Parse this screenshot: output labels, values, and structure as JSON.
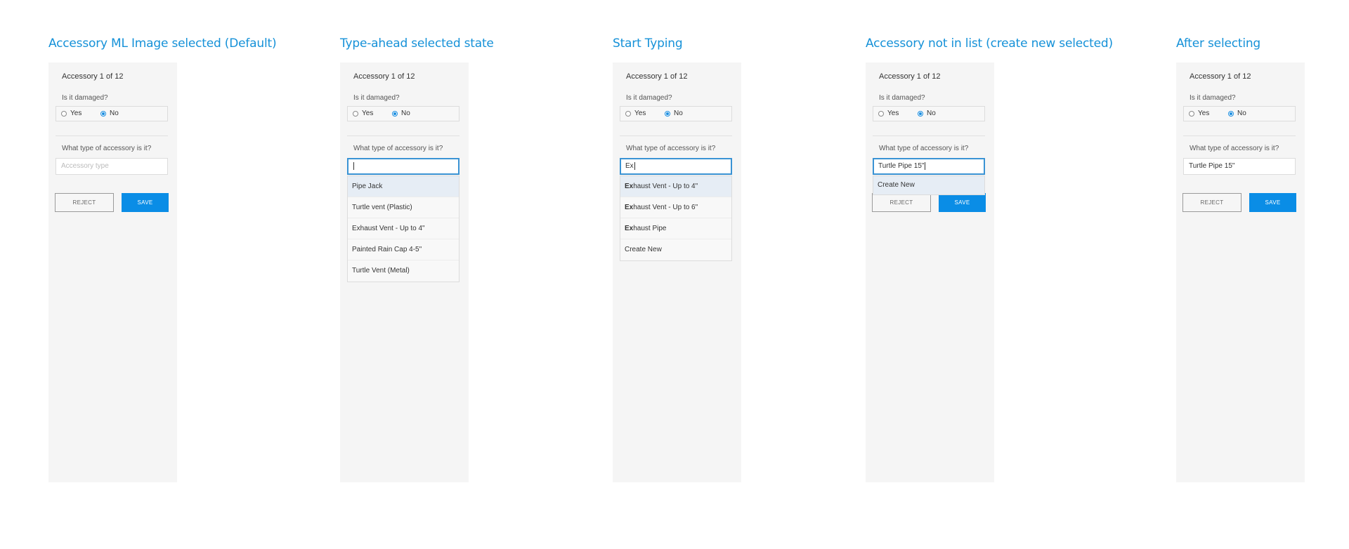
{
  "common": {
    "counter": "Accessory 1 of 12",
    "damaged_question": "Is it damaged?",
    "yes_label": "Yes",
    "no_label": "No",
    "type_question": "What type of accessory is it?",
    "reject_label": "REJECT",
    "save_label": "SAVE"
  },
  "columns": [
    {
      "title": "Accessory ML Image selected (Default)",
      "input_value": "",
      "input_placeholder": "Accessory type"
    },
    {
      "title": "Type-ahead selected state",
      "input_value": "",
      "dropdown": [
        "Pipe Jack",
        "Turtle vent (Plastic)",
        "Exhaust Vent - Up to 4\"",
        "Painted Rain Cap 4-5\"",
        "Turtle Vent (Metal)"
      ]
    },
    {
      "title": "Start Typing",
      "input_value": "Ex",
      "dropdown": [
        {
          "match": "Ex",
          "rest": "haust Vent - Up to 4\""
        },
        {
          "match": "Ex",
          "rest": "haust Vent - Up to 6\""
        },
        {
          "match": "Ex",
          "rest": "haust Pipe"
        },
        {
          "match": "",
          "rest": "Create New"
        }
      ]
    },
    {
      "title": "Accessory not in list (create new selected)",
      "input_value": "Turtle Pipe 15\"",
      "dropdown": [
        "Create New"
      ]
    },
    {
      "title": "After selecting",
      "input_value": "Turtle Pipe 15\""
    }
  ],
  "colors": {
    "title_blue": "#1591d8",
    "save_blue": "#0a8de6",
    "panel_bg": "#f5f5f5",
    "highlight": "#e6edf5"
  }
}
